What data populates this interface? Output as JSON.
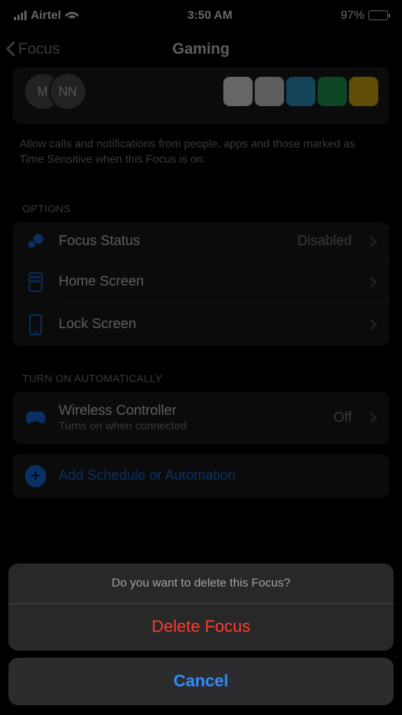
{
  "status": {
    "carrier": "Airtel",
    "time": "3:50 AM",
    "battery": "97%"
  },
  "nav": {
    "back": "Focus",
    "title": "Gaming"
  },
  "allowed": {
    "avatars": [
      "M",
      "NN"
    ],
    "footer": "Allow calls and notifications from people, apps and those marked as Time Sensitive when this Focus is on."
  },
  "options": {
    "header": "OPTIONS",
    "items": [
      {
        "label": "Focus Status",
        "value": "Disabled"
      },
      {
        "label": "Home Screen",
        "value": ""
      },
      {
        "label": "Lock Screen",
        "value": ""
      }
    ]
  },
  "auto": {
    "header": "TURN ON AUTOMATICALLY",
    "item": {
      "label": "Wireless Controller",
      "sub": "Turns on when connected",
      "value": "Off"
    },
    "add": "Add Schedule or Automation"
  },
  "sheet": {
    "prompt": "Do you want to delete this Focus?",
    "delete": "Delete Focus",
    "cancel": "Cancel"
  }
}
